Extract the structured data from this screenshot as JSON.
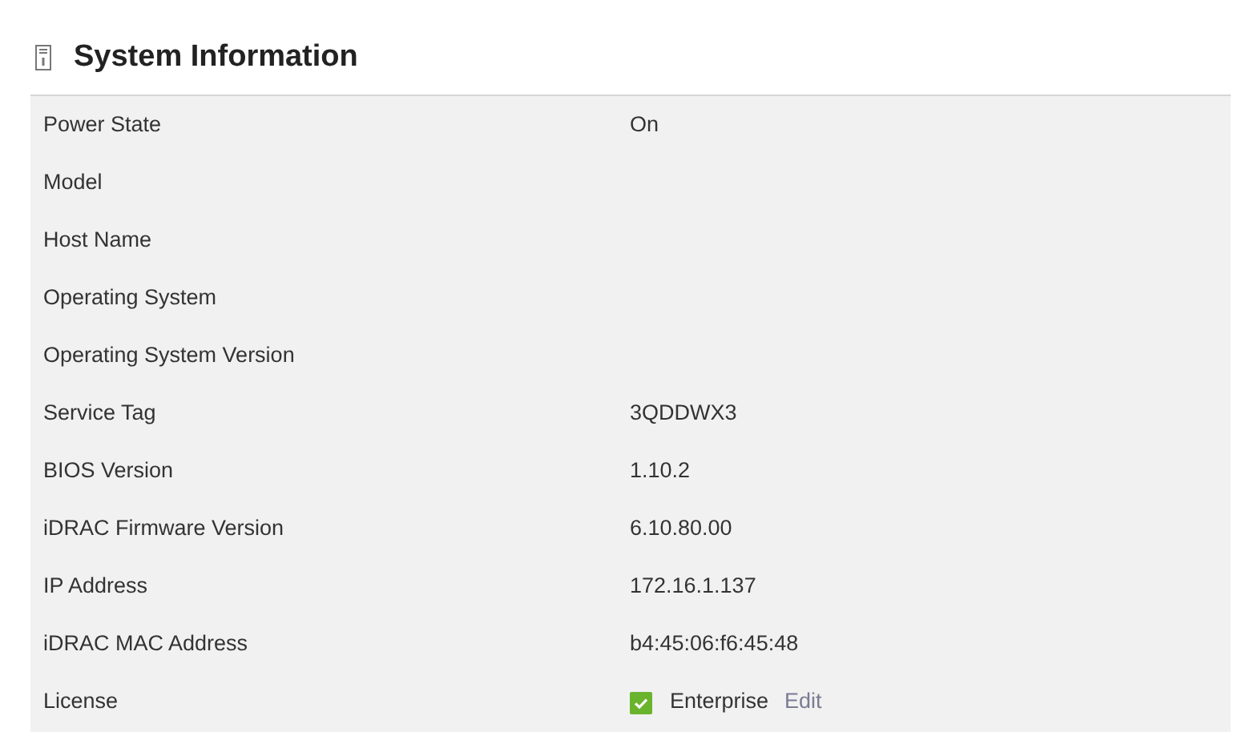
{
  "title": "System Information",
  "rows": [
    {
      "label": "Power State",
      "value": "On"
    },
    {
      "label": "Model"
    },
    {
      "label": "Host Name"
    },
    {
      "label": "Operating System"
    },
    {
      "label": "Operating System Version"
    },
    {
      "label": "Service Tag",
      "value": "3QDDWX3"
    },
    {
      "label": "BIOS Version",
      "value": "1.10.2"
    },
    {
      "label": "iDRAC Firmware Version",
      "value": "6.10.80.00"
    },
    {
      "label": "IP Address",
      "value": "172.16.1.137"
    },
    {
      "label": "iDRAC MAC Address",
      "value": "b4:45:06:f6:45:48"
    },
    {
      "label": "License",
      "value": "Enterprise",
      "status_ok": true,
      "link": "Edit"
    }
  ]
}
